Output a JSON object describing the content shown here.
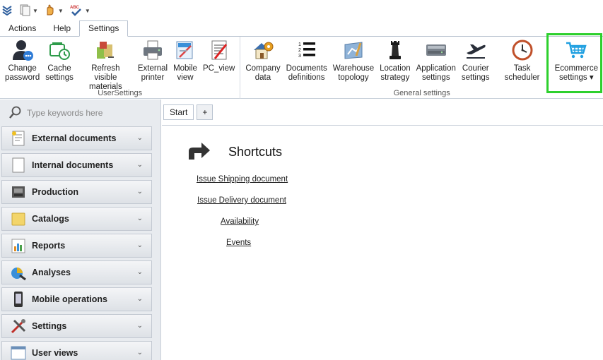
{
  "quick_access": [
    {
      "icon": "app-menu-icon"
    },
    {
      "icon": "documents-icon"
    },
    {
      "icon": "hand-icon"
    },
    {
      "icon": "spellcheck-icon",
      "text": "ABC"
    }
  ],
  "menu_tabs": [
    "Actions",
    "Help",
    "Settings"
  ],
  "ribbon": {
    "groups": [
      {
        "label": "UserSettings",
        "buttons": [
          {
            "label": "Change\npassword",
            "icon": "user-password-icon"
          },
          {
            "label": "Cache\nsettings",
            "icon": "cache-settings-icon"
          },
          {
            "label": "Refresh visible\nmaterials",
            "icon": "refresh-materials-icon"
          },
          {
            "label": "External\nprinter",
            "icon": "printer-icon"
          },
          {
            "label": "Mobile\nview",
            "icon": "mobile-view-icon"
          },
          {
            "label": "PC_view",
            "icon": "pc-view-icon"
          }
        ]
      },
      {
        "label": "General settings",
        "buttons": [
          {
            "label": "Company\ndata",
            "icon": "company-data-icon"
          },
          {
            "label": "Documents\ndefinitions",
            "icon": "numbered-list-icon"
          },
          {
            "label": "Warehouse\ntopology",
            "icon": "warehouse-topology-icon"
          },
          {
            "label": "Location\nstrategy",
            "icon": "chess-piece-icon"
          },
          {
            "label": "Application\nsettings",
            "icon": "application-settings-icon"
          },
          {
            "label": "Courier\nsettings",
            "icon": "airplane-icon"
          },
          {
            "label": "Task scheduler",
            "icon": "clock-icon"
          },
          {
            "label": "Ecommerce\nsettings ▾",
            "icon": "shopping-cart-icon"
          }
        ]
      }
    ]
  },
  "search": {
    "placeholder": "Type keywords here"
  },
  "nav_items": [
    {
      "label": "External documents",
      "icon": "external-documents-icon"
    },
    {
      "label": "Internal documents",
      "icon": "internal-documents-icon"
    },
    {
      "label": "Production",
      "icon": "production-icon"
    },
    {
      "label": "Catalogs",
      "icon": "catalogs-icon"
    },
    {
      "label": "Reports",
      "icon": "reports-icon"
    },
    {
      "label": "Analyses",
      "icon": "analyses-icon"
    },
    {
      "label": "Mobile operations",
      "icon": "mobile-operations-icon"
    },
    {
      "label": "Settings",
      "icon": "settings-tools-icon"
    },
    {
      "label": "User views",
      "icon": "user-views-icon"
    }
  ],
  "doc_tabs": [
    "Start",
    "+"
  ],
  "shortcuts": {
    "title": "Shortcuts",
    "links": [
      "Issue Shipping document",
      "Issue Delivery document",
      "Availability",
      "Events"
    ]
  },
  "colors": {
    "highlight": "#2dd02d",
    "accent": "#1f9fe0"
  }
}
